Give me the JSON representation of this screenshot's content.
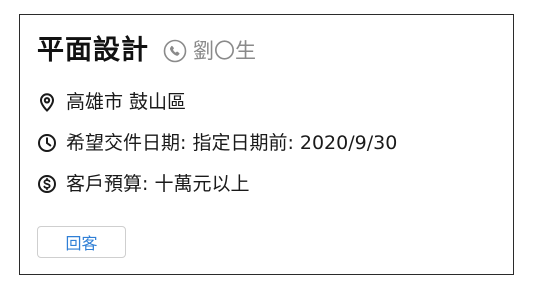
{
  "card": {
    "title": "平面設計",
    "contact": {
      "icon": "phone-icon",
      "name": "劉〇生"
    },
    "details": [
      {
        "icon": "location-pin-icon",
        "text": "高雄市 鼓山區"
      },
      {
        "icon": "clock-icon",
        "text": "希望交件日期: 指定日期前: 2020/9/30"
      },
      {
        "icon": "dollar-circle-icon",
        "text": "客戶預算: 十萬元以上"
      }
    ],
    "reply_label": "回客"
  },
  "colors": {
    "accent": "#2f7fd6",
    "muted": "#8a8a8a",
    "border": "#2b2b2b"
  }
}
